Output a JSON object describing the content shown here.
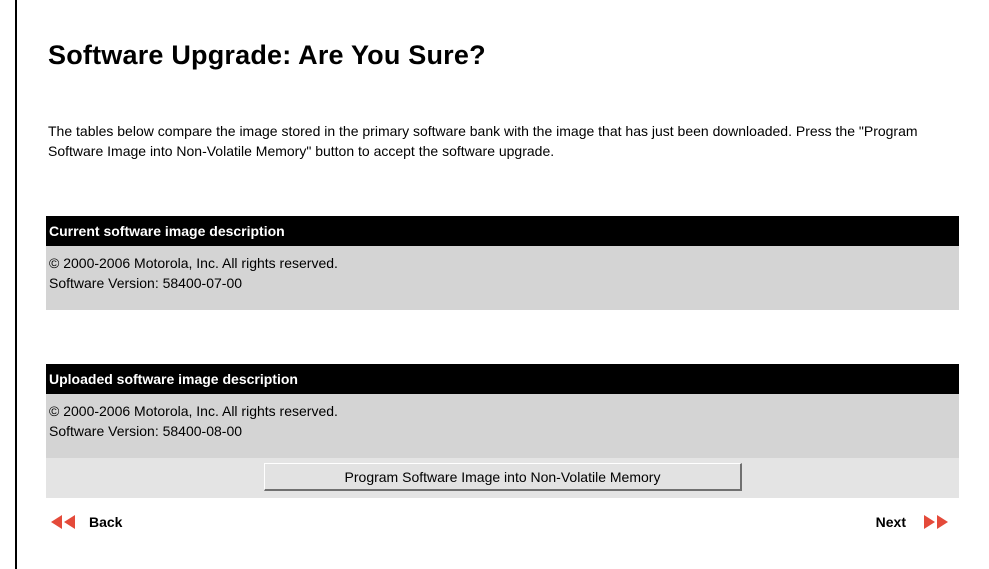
{
  "page": {
    "title": "Software Upgrade: Are You Sure?",
    "intro": "The tables below compare the image stored in the primary software bank with the image that has just been downloaded. Press the \"Program Software Image into Non-Volatile Memory\" button to accept the software upgrade."
  },
  "current": {
    "header": "Current software image description",
    "copyright": "© 2000-2006 Motorola, Inc. All rights reserved.",
    "version": "Software Version: 58400-07-00"
  },
  "uploaded": {
    "header": "Uploaded software image description",
    "copyright": "© 2000-2006 Motorola, Inc. All rights reserved.",
    "version": "Software Version: 58400-08-00"
  },
  "actions": {
    "program_label": "Program Software Image into Non-Volatile Memory"
  },
  "nav": {
    "back_label": "Back",
    "next_label": "Next",
    "back_icon": "double-arrow-left-icon",
    "next_icon": "double-arrow-right-icon",
    "arrow_color": "#e44a3a"
  }
}
